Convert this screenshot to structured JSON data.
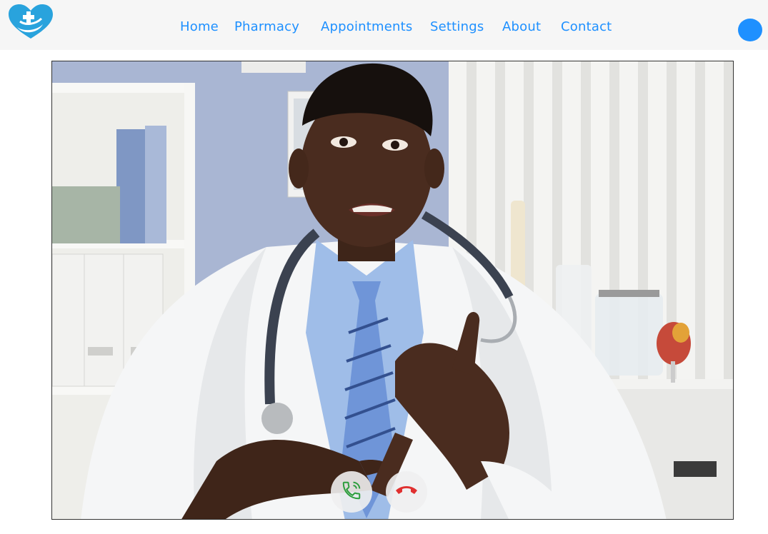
{
  "header": {
    "logo": "heart-cross-logo",
    "nav": [
      {
        "label": "Home"
      },
      {
        "label": "Pharmacy"
      },
      {
        "label": "Appointments"
      },
      {
        "label": "Settings"
      },
      {
        "label": "About"
      },
      {
        "label": "Contact"
      }
    ],
    "avatar_color": "#1e90ff"
  },
  "video_call": {
    "accept_icon": "phone-icon",
    "accept_color": "#2e9e3e",
    "decline_icon": "phone-hangup-icon",
    "decline_color": "#e03030"
  },
  "colors": {
    "accent": "#1e90ff",
    "navbar_bg": "#f6f6f6"
  }
}
